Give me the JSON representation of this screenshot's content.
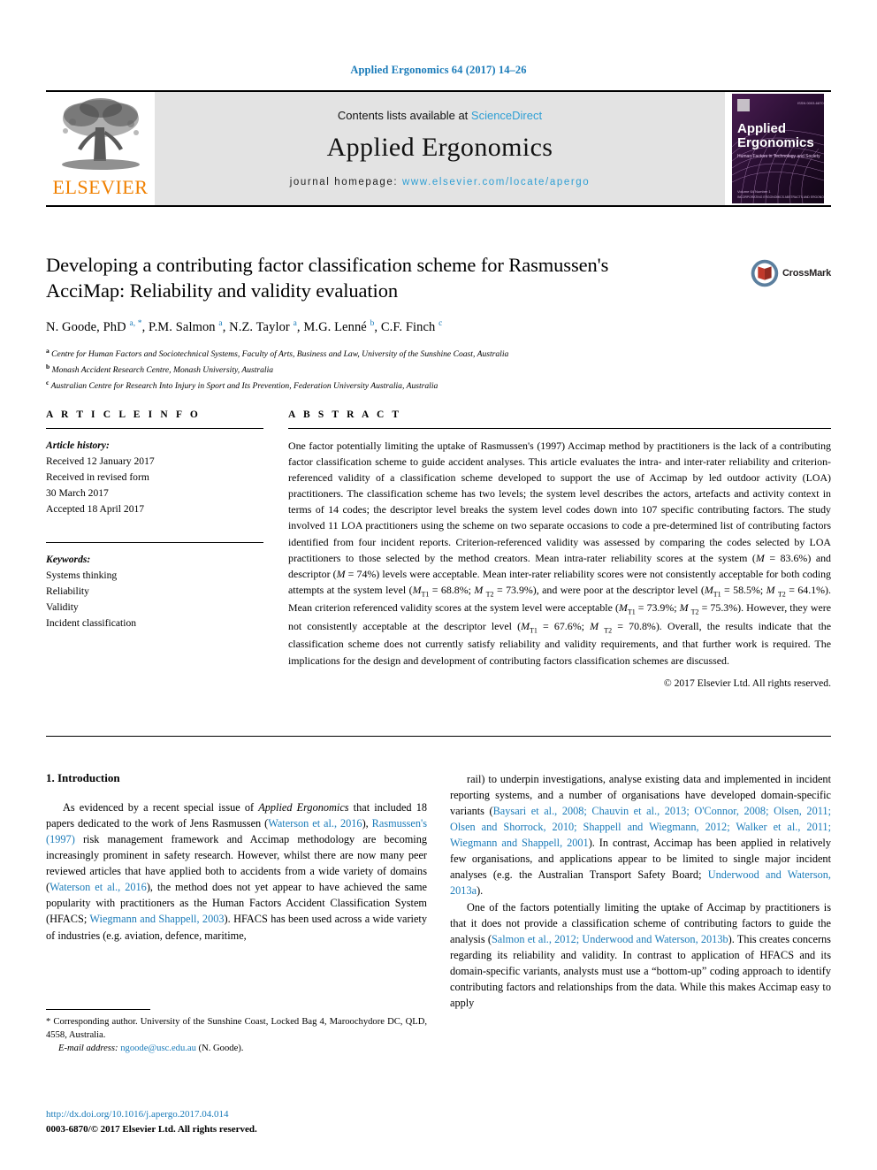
{
  "running_head": "Applied Ergonomics 64 (2017) 14–26",
  "masthead": {
    "publisher_name": "ELSEVIER",
    "contents_prefix": "Contents lists available at ",
    "sciencedirect": "ScienceDirect",
    "journal_name": "Applied Ergonomics",
    "homepage_prefix": "journal homepage: ",
    "homepage_url": "www.elsevier.com/locate/apergo",
    "cover_title_line1": "Applied",
    "cover_title_line2": "Ergonomics"
  },
  "crossmark": {
    "label": "CrossMark"
  },
  "title": "Developing a contributing factor classification scheme for Rasmussen's AcciMap: Reliability and validity evaluation",
  "authors_html": "N. Goode, PhD <sup>a, *</sup>, P.M. Salmon <sup>a</sup>, N.Z. Taylor <sup>a</sup>, M.G. Lenné <sup>b</sup>, C.F. Finch <sup>c</sup>",
  "affiliations": [
    {
      "marker": "a",
      "text": "Centre for Human Factors and Sociotechnical Systems, Faculty of Arts, Business and Law, University of the Sunshine Coast, Australia"
    },
    {
      "marker": "b",
      "text": "Monash Accident Research Centre, Monash University, Australia"
    },
    {
      "marker": "c",
      "text": "Australian Centre for Research Into Injury in Sport and Its Prevention, Federation University Australia, Australia"
    }
  ],
  "article_info": {
    "heading": "A R T I C L E  I N F O",
    "history_label": "Article history:",
    "history": [
      "Received 12 January 2017",
      "Received in revised form",
      "30 March 2017",
      "Accepted 18 April 2017"
    ],
    "keywords_label": "Keywords:",
    "keywords": [
      "Systems thinking",
      "Reliability",
      "Validity",
      "Incident classification"
    ]
  },
  "abstract": {
    "heading": "A B S T R A C T",
    "body_html": "One factor potentially limiting the uptake of Rasmussen's (1997) Accimap method by practitioners is the lack of a contributing factor classification scheme to guide accident analyses. This article evaluates the intra- and inter-rater reliability and criterion-referenced validity of a classification scheme developed to support the use of Accimap by led outdoor activity (LOA) practitioners. The classification scheme has two levels; the system level describes the actors, artefacts and activity context in terms of 14 codes; the descriptor level breaks the system level codes down into 107 specific contributing factors. The study involved 11 LOA practitioners using the scheme on two separate occasions to code a pre-determined list of contributing factors identified from four incident reports. Criterion-referenced validity was assessed by comparing the codes selected by LOA practitioners to those selected by the method creators. Mean intra-rater reliability scores at the system (<i>M</i> = 83.6%) and descriptor (<i>M</i> = 74%) levels were acceptable. Mean inter-rater reliability scores were not consistently acceptable for both coding attempts at the system level (<i>M</i><sub>T1</sub> = 68.8%; <i>M</i> <sub>T2</sub> = 73.9%), and were poor at the descriptor level (<i>M</i><sub>T1</sub> = 58.5%; <i>M</i> <sub>T2</sub> = 64.1%). Mean criterion referenced validity scores at the system level were acceptable (<i>M</i><sub>T1</sub> = 73.9%; <i>M</i> <sub>T2</sub> = 75.3%). However, they were not consistently acceptable at the descriptor level (<i>M</i><sub>T1</sub> = 67.6%; <i>M</i> <sub>T2</sub> = 70.8%). Overall, the results indicate that the classification scheme does not currently satisfy reliability and validity requirements, and that further work is required. The implications for the design and development of contributing factors classification schemes are discussed.",
    "copyright": "© 2017 Elsevier Ltd. All rights reserved."
  },
  "introduction": {
    "heading": "1. Introduction",
    "left_paragraphs_html": [
      "As evidenced by a recent special issue of <i>Applied Ergonomics</i> that included 18 papers dedicated to the work of Jens Rasmussen (<span class=\"cite\">Waterson et al., 2016</span>), <span class=\"cite\">Rasmussen's (1997)</span> risk management framework and Accimap methodology are becoming increasingly prominent in safety research. However, whilst there are now many peer reviewed articles that have applied both to accidents from a wide variety of domains (<span class=\"cite\">Waterson et al., 2016</span>), the method does not yet appear to have achieved the same popularity with practitioners as the Human Factors Accident Classification System (HFACS; <span class=\"cite\">Wiegmann and Shappell, 2003</span>). HFACS has been used across a wide variety of industries (e.g. aviation, defence, maritime,"
    ],
    "right_paragraphs_html": [
      "rail) to underpin investigations, analyse existing data and implemented in incident reporting systems, and a number of organisations have developed domain-specific variants (<span class=\"cite\">Baysari et al., 2008; Chauvin et al., 2013; O'Connor, 2008; Olsen, 2011; Olsen and Shorrock, 2010; Shappell and Wiegmann, 2012; Walker et al., 2011; Wiegmann and Shappell, 2001</span>). In contrast, Accimap has been applied in relatively few organisations, and applications appear to be limited to single major incident analyses (e.g. the Australian Transport Safety Board; <span class=\"cite\">Underwood and Waterson, 2013a</span>).",
      "One of the factors potentially limiting the uptake of Accimap by practitioners is that it does not provide a classification scheme of contributing factors to guide the analysis (<span class=\"cite\">Salmon et al., 2012; Underwood and Waterson, 2013b</span>). This creates concerns regarding its reliability and validity. In contrast to application of HFACS and its domain-specific variants, analysts must use a “bottom-up” coding approach to identify contributing factors and relationships from the data. While this makes Accimap easy to apply"
    ]
  },
  "footnote": {
    "corresponding_html": "* Corresponding author. University of the Sunshine Coast, Locked Bag 4, Maroochydore DC, QLD, 4558, Australia.",
    "email_label": "E-mail address:",
    "email": "ngoode@usc.edu.au",
    "email_suffix": "(N. Goode)."
  },
  "doi_block": {
    "doi_url": "http://dx.doi.org/10.1016/j.apergo.2017.04.014",
    "issn_line": "0003-6870/© 2017 Elsevier Ltd. All rights reserved."
  },
  "colors": {
    "link_blue": "#1a7bb9",
    "sciencedirect_blue": "#2e9fd4",
    "elsevier_orange": "#f08000",
    "band_grey": "#e3e3e3"
  }
}
